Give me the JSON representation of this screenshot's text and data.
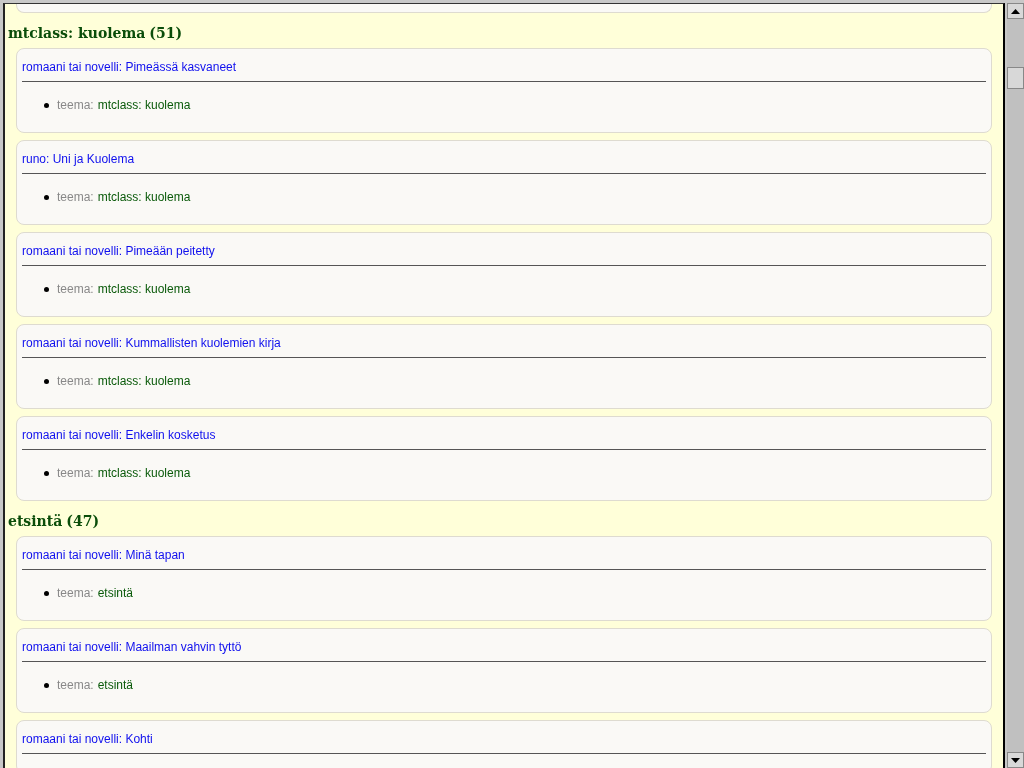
{
  "sections": [
    {
      "heading": "mtclass: kuolema",
      "count": "(51)",
      "items": [
        {
          "title": "romaani tai novelli: Pimeässä kasvaneet",
          "properties": [
            {
              "label": "teema:",
              "value": "mtclass: kuolema"
            }
          ]
        },
        {
          "title": "runo: Uni ja Kuolema",
          "properties": [
            {
              "label": "teema:",
              "value": "mtclass: kuolema"
            }
          ]
        },
        {
          "title": "romaani tai novelli: Pimeään peitetty",
          "properties": [
            {
              "label": "teema:",
              "value": "mtclass: kuolema"
            }
          ]
        },
        {
          "title": "romaani tai novelli: Kummallisten kuolemien kirja",
          "properties": [
            {
              "label": "teema:",
              "value": "mtclass: kuolema"
            }
          ]
        },
        {
          "title": "romaani tai novelli: Enkelin kosketus",
          "properties": [
            {
              "label": "teema:",
              "value": "mtclass: kuolema"
            }
          ]
        }
      ]
    },
    {
      "heading": "etsintä",
      "count": "(47)",
      "items": [
        {
          "title": "romaani tai novelli: Minä tapan",
          "properties": [
            {
              "label": "teema:",
              "value": "etsintä"
            }
          ]
        },
        {
          "title": "romaani tai novelli: Maailman vahvin tyttö",
          "properties": [
            {
              "label": "teema:",
              "value": "etsintä"
            }
          ]
        },
        {
          "title": "romaani tai novelli: Kohti"
        }
      ]
    }
  ]
}
